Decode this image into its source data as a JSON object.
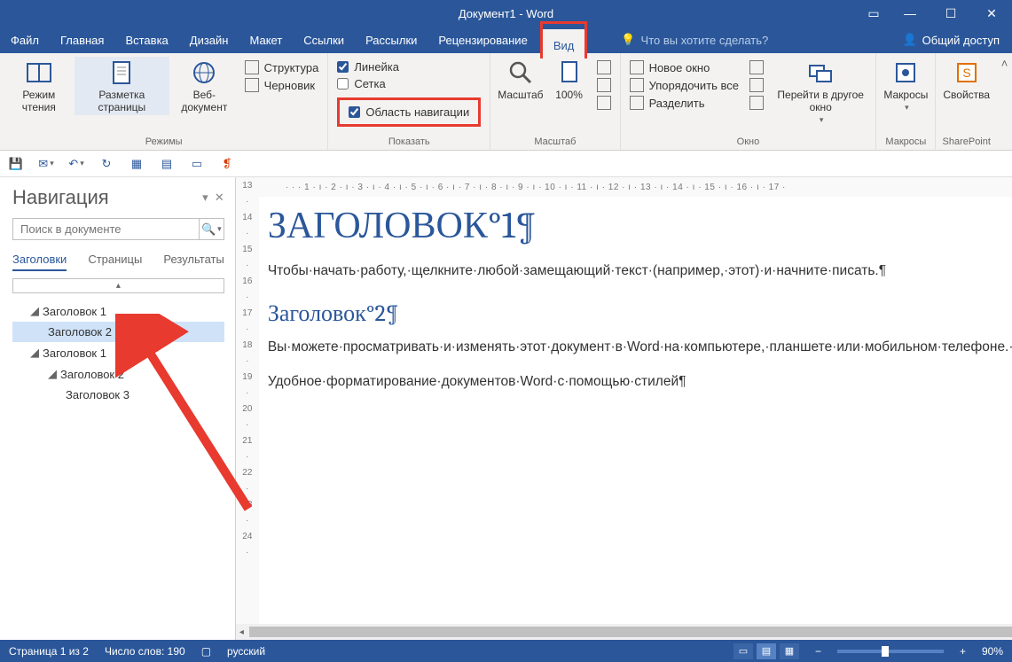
{
  "window": {
    "title": "Документ1 - Word"
  },
  "tabs": {
    "file": "Файл",
    "home": "Главная",
    "insert": "Вставка",
    "design": "Дизайн",
    "layout": "Макет",
    "references": "Ссылки",
    "mailings": "Рассылки",
    "review": "Рецензирование",
    "view": "Вид",
    "tellme": "Что вы хотите сделать?",
    "share": "Общий доступ"
  },
  "ribbon": {
    "modes": {
      "read": "Режим чтения",
      "print": "Разметка страницы",
      "web": "Веб-документ",
      "label": "Режимы"
    },
    "views": {
      "outline": "Структура",
      "draft": "Черновик"
    },
    "show": {
      "ruler": "Линейка",
      "grid": "Сетка",
      "navpane": "Область навигации",
      "label": "Показать"
    },
    "zoom": {
      "zoom": "Масштаб",
      "hundred": "100%",
      "label": "Масштаб"
    },
    "window": {
      "new": "Новое окно",
      "arrange": "Упорядочить все",
      "split": "Разделить",
      "switch": "Перейти в другое окно",
      "label": "Окно"
    },
    "macros": {
      "macros": "Макросы",
      "label": "Макросы"
    },
    "sharepoint": {
      "props": "Свойства",
      "label": "SharePoint"
    }
  },
  "nav": {
    "title": "Навигация",
    "search_placeholder": "Поиск в документе",
    "tabs": {
      "headings": "Заголовки",
      "pages": "Страницы",
      "results": "Результаты"
    },
    "tree": [
      {
        "text": "Заголовок 1",
        "lv": 1,
        "exp": true
      },
      {
        "text": "Заголовок 2",
        "lv": 2,
        "sel": true
      },
      {
        "text": "Заголовок 1",
        "lv": 1,
        "exp": true
      },
      {
        "text": "Заголовок 2",
        "lv": 2,
        "exp": true
      },
      {
        "text": "Заголовок 3",
        "lv": 3
      }
    ]
  },
  "doc": {
    "h1": "ЗАГОЛОВОК°1¶",
    "p1": "Чтобы·начать·работу,·щелкните·любой·замещающий·текст·(например,·этот)·и·начните·писать.¶",
    "h2": "Заголовок°2¶",
    "p2": "Вы·можете·просматривать·и·изменять·этот·документ·в·Word·на·компьютере,·планшете·или·мобильном·телефоне.·Редактируйте·текст,·вставляйте·содержимое,·например·рисунки,·фигуры·и·таблицы,·и·сохраняйте·документ·в·облаке·с·помощью·приложения·Word·на·компьютерах·Mac,·устройствах·с·Windows,·Android·или·iOS.¶",
    "p3": "Удобное·форматирование·документов·Word·с·помощью·стилей¶"
  },
  "ruler_h": "· · · 1 · ı · 2 · ı · 3 · ı · 4 · ı · 5 · ı · 6 · ı · 7 · ı · 8 · ı · 9 · ı · 10 · ı · 11 · ı · 12 · ı · 13 · ı · 14 · ı · 15 · ı · 16 · ı · 17 ·",
  "ruler_v_start": 13,
  "status": {
    "page": "Страница 1 из 2",
    "words": "Число слов: 190",
    "lang": "русский",
    "zoom": "90%"
  }
}
